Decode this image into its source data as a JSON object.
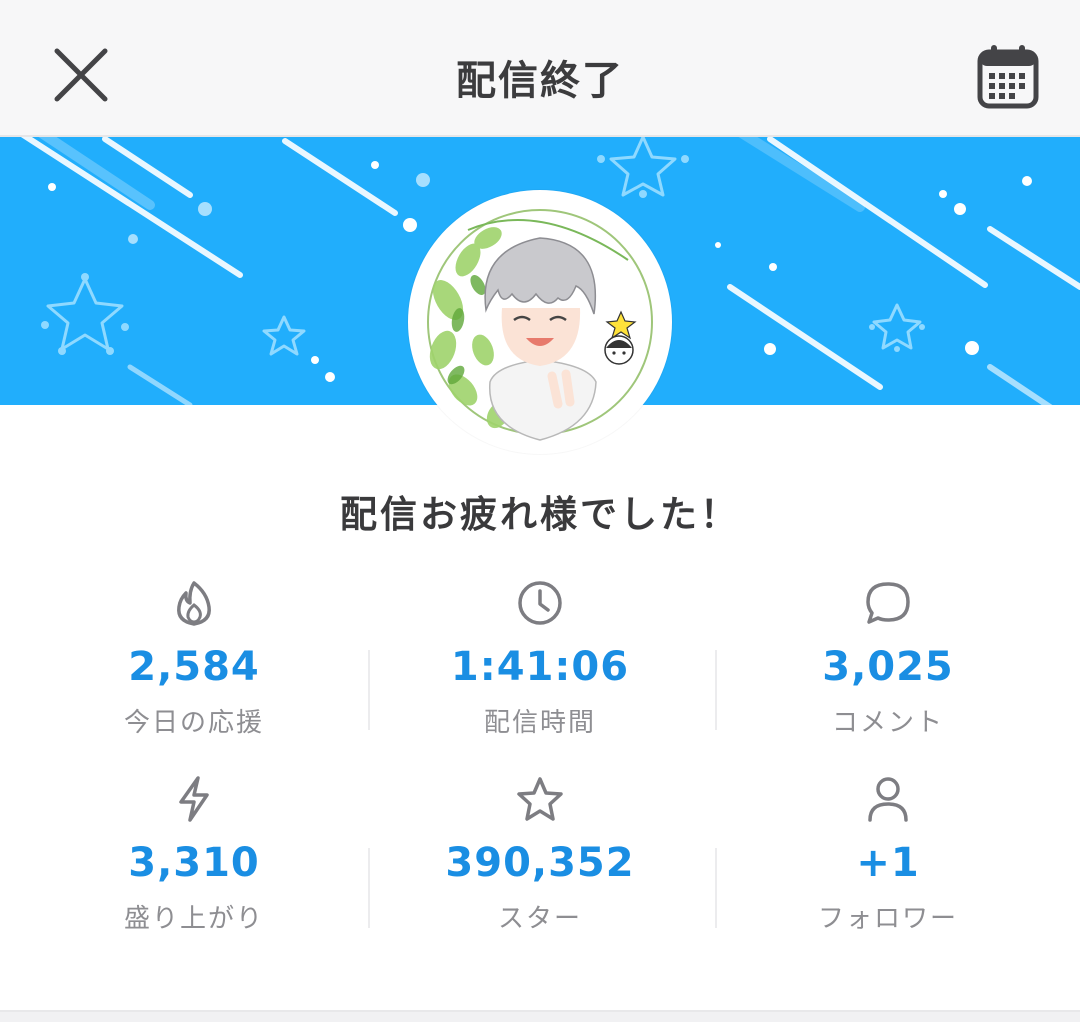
{
  "header": {
    "title": "配信終了",
    "close_icon": "close-icon",
    "calendar_icon": "calendar-icon"
  },
  "banner": {
    "background_color": "#21aefc"
  },
  "greeting": "配信お疲れ様でした！",
  "stats": [
    {
      "icon": "flame-icon",
      "value": "2,584",
      "label": "今日の応援"
    },
    {
      "icon": "clock-icon",
      "value": "1:41:06",
      "label": "配信時間"
    },
    {
      "icon": "comment-icon",
      "value": "3,025",
      "label": "コメント"
    },
    {
      "icon": "lightning-icon",
      "value": "3,310",
      "label": "盛り上がり"
    },
    {
      "icon": "star-icon",
      "value": "390,352",
      "label": "スター"
    },
    {
      "icon": "person-icon",
      "value": "+1",
      "label": "フォロワー"
    }
  ],
  "colors": {
    "accent": "#1a8ee3",
    "label": "#8e8e92",
    "title": "#3c3c3e"
  }
}
